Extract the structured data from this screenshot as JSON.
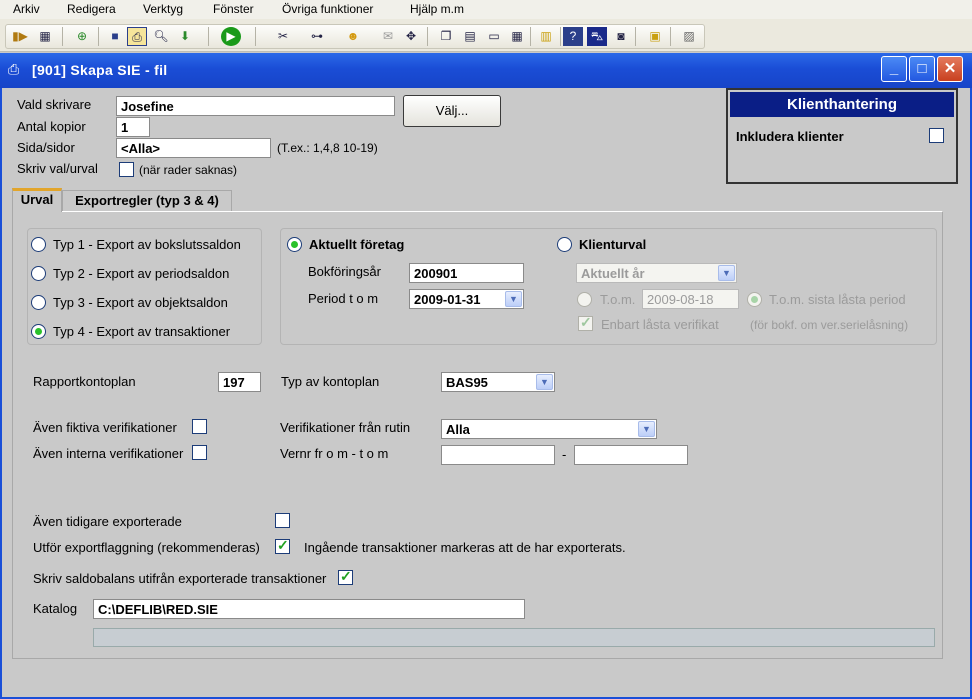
{
  "menubar": {
    "items": [
      "Arkiv",
      "Redigera",
      "Verktyg",
      "Fönster",
      "Övriga funktioner",
      "Hjälp m.m"
    ]
  },
  "toolbar": {
    "icons": [
      "exit-icon",
      "calculator-icon",
      "new-icon",
      "save-icon",
      "print-icon",
      "preview-icon",
      "download-icon",
      "run-icon",
      "scissors-icon",
      "tree-icon",
      "user-icon",
      "mail-icon",
      "move-icon",
      "window-icon",
      "tile-icon",
      "cascade-icon",
      "grid-icon",
      "notes-icon",
      "help-icon",
      "car-icon",
      "screen-icon",
      "note-icon",
      "info-icon"
    ]
  },
  "window": {
    "title": "[901]  Skapa SIE - fil"
  },
  "printer": {
    "vald_skrivare_label": "Vald skrivare",
    "vald_skrivare_value": "Josefine",
    "antal_kopior_label": "Antal kopior",
    "antal_kopior_value": "1",
    "sida_label": "Sida/sidor",
    "sida_value": "<Alla>",
    "sida_hint": "(T.ex.: 1,4,8 10-19)",
    "skriv_val_label": "Skriv val/urval",
    "skriv_val_hint": "(när rader saknas)",
    "valj_button": "Välj..."
  },
  "klient": {
    "title": "Klienthantering",
    "inkludera_label": "Inkludera klienter",
    "inkludera_checked": false
  },
  "tabs": [
    {
      "label": "Urval",
      "active": true
    },
    {
      "label": "Exportregler (typ 3 & 4)",
      "active": false
    }
  ],
  "export_types": [
    {
      "label": "Typ 1 - Export av bokslutssaldon",
      "selected": false
    },
    {
      "label": "Typ 2 - Export av periodsaldon",
      "selected": false
    },
    {
      "label": "Typ 3 - Export av objektsaldon",
      "selected": false
    },
    {
      "label": "Typ 4 - Export av transaktioner",
      "selected": true
    }
  ],
  "company": {
    "aktuellt_label": "Aktuellt företag",
    "bokforingsar_label": "Bokföringsår",
    "bokforingsar_value": "200901",
    "period_label": "Period t o m",
    "period_value": "2009-01-31",
    "klienturval_label": "Klienturval",
    "aktuellt_ar_value": "Aktuellt år",
    "tom_label": "T.o.m.",
    "tom_value": "2009-08-18",
    "tom_sista_label": "T.o.m. sista låsta period",
    "enbart_label": "Enbart låsta verifikat",
    "enbart_hint": "(för bokf. om ver.serielåsning)"
  },
  "options": {
    "rapportkontoplan_label": "Rapportkontoplan",
    "rapportkontoplan_value": "197",
    "typ_kontoplan_label": "Typ av kontoplan",
    "typ_kontoplan_value": "BAS95",
    "fiktiva_label": "Även fiktiva verifikationer",
    "interna_label": "Även interna verifikationer",
    "ver_rutin_label": "Verifikationer från rutin",
    "ver_rutin_value": "Alla",
    "vernr_label": "Vernr fr o m - t o m",
    "vernr_dash": "-",
    "tidigare_label": "Även tidigare exporterade",
    "flaggning_label": "Utför exportflaggning (rekommenderas)",
    "flaggning_hint": "Ingående transaktioner markeras att de har exporterats.",
    "saldobalans_label": "Skriv saldobalans utifrån exporterade transaktioner",
    "katalog_label": "Katalog",
    "katalog_value": "C:\\DEFLIB\\RED.SIE"
  }
}
